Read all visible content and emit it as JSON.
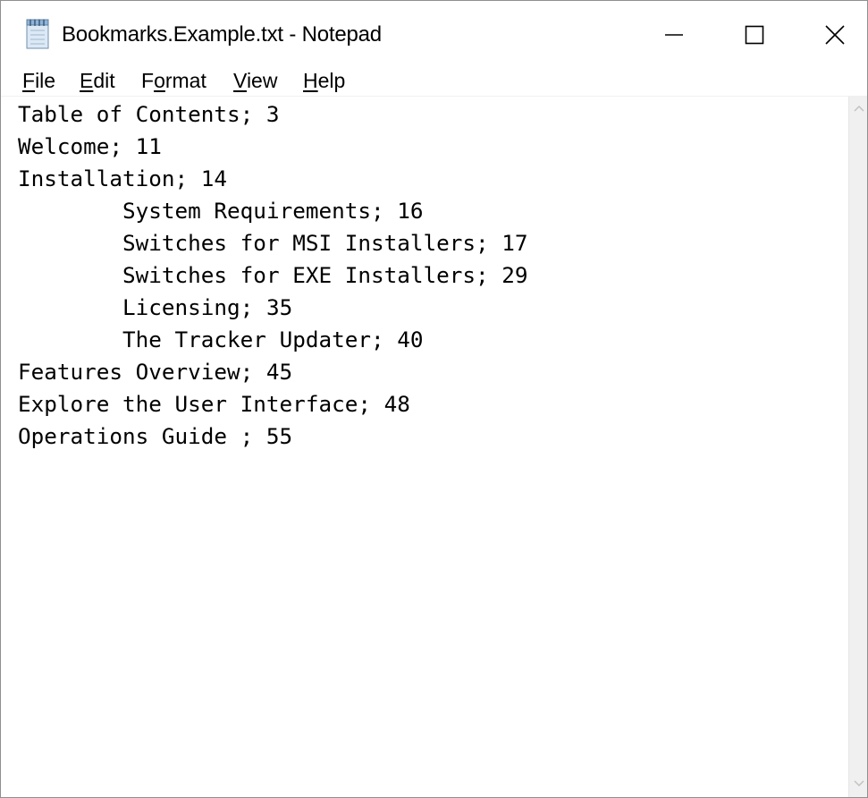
{
  "window": {
    "title": "Bookmarks.Example.txt - Notepad",
    "icon": "notepad-icon",
    "controls": [
      "minimize-icon",
      "maximize-icon",
      "close-icon"
    ]
  },
  "menu": [
    {
      "underline": "F",
      "rest": "ile"
    },
    {
      "underline": "E",
      "rest": "dit"
    },
    {
      "pre": "F",
      "underline": "o",
      "rest": "rmat"
    },
    {
      "underline": "V",
      "rest": "iew"
    },
    {
      "underline": "H",
      "rest": "elp"
    }
  ],
  "editor": {
    "lines": [
      "Table of Contents; 3",
      "Welcome; 11",
      "Installation; 14",
      "\tSystem Requirements; 16",
      "\tSwitches for MSI Installers; 17",
      "\tSwitches for EXE Installers; 29",
      "\tLicensing; 35",
      "\tThe Tracker Updater; 40",
      "Features Overview; 45",
      "Explore the User Interface; 48",
      "Operations Guide ; 55"
    ]
  }
}
